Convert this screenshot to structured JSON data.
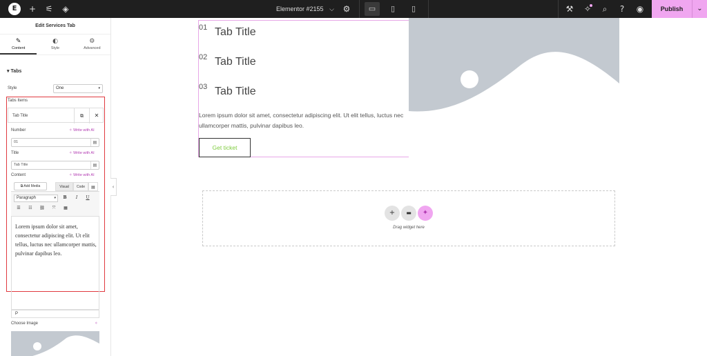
{
  "topbar": {
    "logo": "E",
    "add_icon": "+",
    "settings_icon": "sliders-icon",
    "layers_icon": "layers-icon",
    "doc_title": "Elementor #2155",
    "chevron": "⌵",
    "gear": "⚙",
    "devices": [
      "desktop-icon",
      "tablet-icon",
      "mobile-icon"
    ],
    "publish_label": "Publish",
    "publish_arrow": "⌄"
  },
  "panel": {
    "title": "Edit Services Tab",
    "tabs": [
      {
        "label": "Content",
        "icon": "✎"
      },
      {
        "label": "Style",
        "icon": "◐"
      },
      {
        "label": "Advanced",
        "icon": "⚙"
      }
    ],
    "section": "Tabs",
    "section_caret": "▾",
    "style_label": "Style",
    "style_value": "One",
    "select_arrow": "▾",
    "items_label": "Tabs Items",
    "item_title": "Tab Title",
    "number_label": "Number",
    "write_ai": "Write with AI",
    "number_value": "01",
    "title_label": "Title",
    "title_value": "Tab Title",
    "content_label": "Content",
    "add_media": "Add Media",
    "visual": "Visual",
    "code": "Code",
    "paragraph": "Paragraph",
    "editor_text": "Lorem ipsum dolor sit amet, consectetur adipiscing elit. Ut elit tellus, luctus nec ullamcorper mattis, pulvinar dapibus leo.",
    "status_p": "P",
    "choose_image": "Choose Image"
  },
  "canvas": {
    "tabs": [
      {
        "num": "01",
        "title": "Tab Title"
      },
      {
        "num": "02",
        "title": "Tab Title"
      },
      {
        "num": "03",
        "title": "Tab Title"
      }
    ],
    "content": "Lorem ipsum dolor sit amet, consectetur adipiscing elit. Ut elit tellus, luctus nec ullamcorper mattis, pulvinar dapibus leo.",
    "button_label": "Get ticket",
    "drop_text": "Drag widget here",
    "drop_buttons": [
      "+",
      "▬",
      "✦"
    ]
  },
  "colors": {
    "accent": "#f0a6f0",
    "ai": "#b23bb2",
    "ticket": "#7fcc3f",
    "placeholder": "#c3c9d0",
    "highlight": "#e0383e"
  }
}
